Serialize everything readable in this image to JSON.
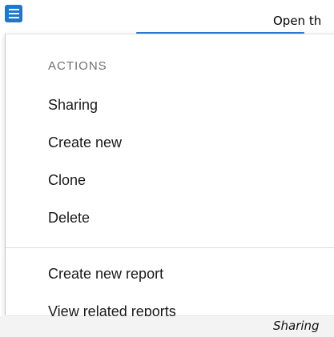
{
  "header": {
    "menu_icon": "hamburger-menu-icon",
    "partial_text": "Open th",
    "accent_color": "#1f77c9"
  },
  "menu": {
    "section_title": "ACTIONS",
    "items": [
      {
        "label": "Sharing"
      },
      {
        "label": "Create new"
      },
      {
        "label": "Clone"
      },
      {
        "label": "Delete"
      }
    ],
    "secondary_items": [
      {
        "label": "Create new report"
      },
      {
        "label": "View related reports"
      }
    ]
  },
  "footer": {
    "caption": "Sharing"
  }
}
